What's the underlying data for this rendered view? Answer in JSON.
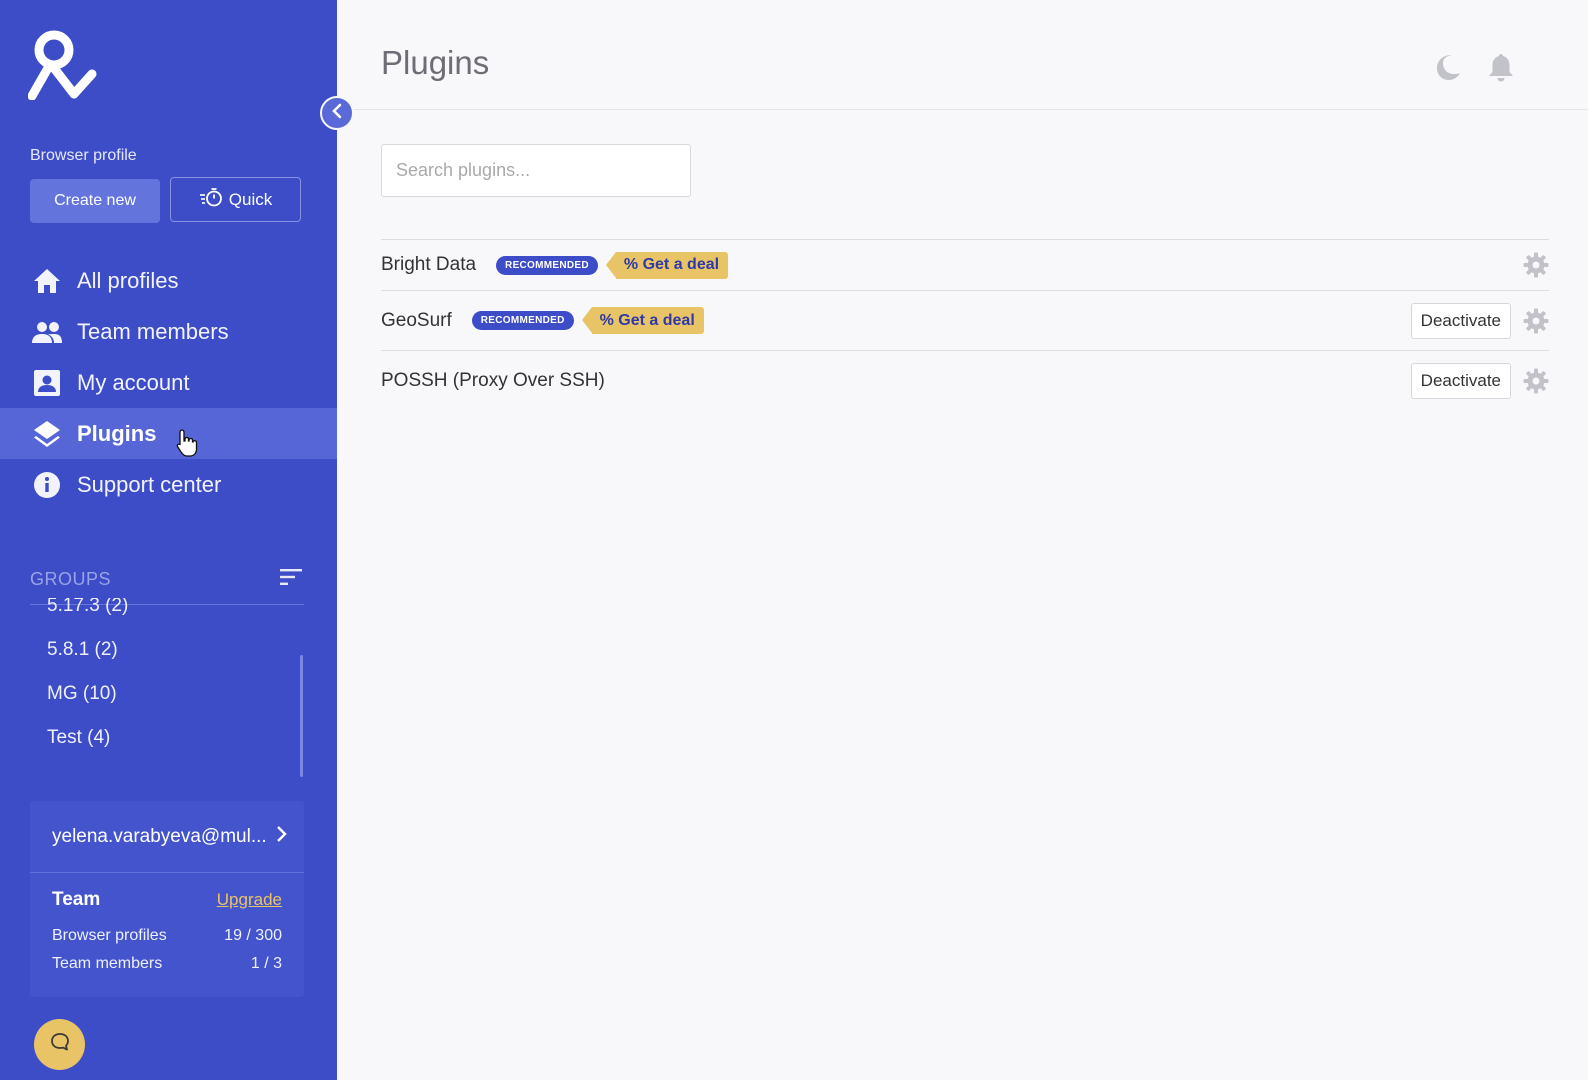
{
  "sidebar": {
    "browser_profile_label": "Browser profile",
    "create_new_label": "Create new",
    "quick_label": "Quick",
    "nav": [
      {
        "label": "All profiles",
        "icon": "home-icon"
      },
      {
        "label": "Team members",
        "icon": "team-icon"
      },
      {
        "label": "My account",
        "icon": "account-icon"
      },
      {
        "label": "Plugins",
        "icon": "layers-icon",
        "active": true
      },
      {
        "label": "Support center",
        "icon": "info-icon"
      }
    ],
    "groups_title": "GROUPS",
    "groups": [
      {
        "label": "5.17.3  (2)"
      },
      {
        "label": "5.8.1  (2)"
      },
      {
        "label": "MG  (10)"
      },
      {
        "label": "Test  (4)"
      }
    ],
    "account": {
      "email": "yelena.varabyeva@mul...",
      "plan_name": "Team",
      "upgrade_label": "Upgrade",
      "browser_profiles_label": "Browser profiles",
      "browser_profiles_value": "19 / 300",
      "team_members_label": "Team members",
      "team_members_value": "1 / 3"
    }
  },
  "main": {
    "title": "Plugins",
    "search_placeholder": "Search plugins...",
    "plugins": [
      {
        "name": "Bright Data",
        "badge": "RECOMMENDED",
        "deal": "% Get a deal",
        "deactivate": ""
      },
      {
        "name": "GeoSurf",
        "badge": "RECOMMENDED",
        "deal": "% Get a deal",
        "deactivate": "Deactivate"
      },
      {
        "name": "POSSH (Proxy Over SSH)",
        "badge": "",
        "deal": "",
        "deactivate": "Deactivate"
      }
    ]
  },
  "colors": {
    "sidebar_bg": "#3d4cc7",
    "active_item": "#5766d6",
    "accent_yellow": "#e8c466",
    "badge_blue": "#3d4cc7"
  }
}
